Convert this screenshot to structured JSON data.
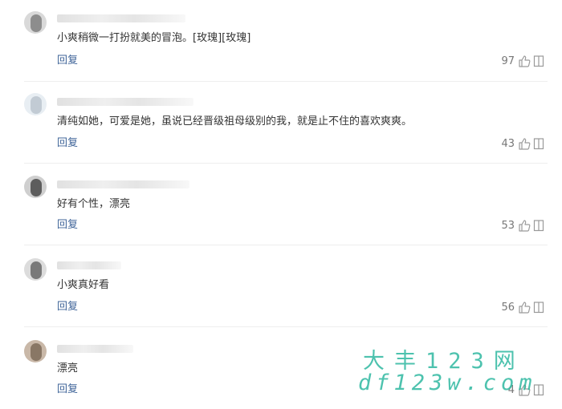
{
  "comments": [
    {
      "text": "小爽稍微一打扮就美的冒泡。[玫瑰][玫瑰]",
      "reply_label": "回复",
      "likes": "97",
      "like_icon": "thumb-up-icon",
      "more_icon": "tray-icon"
    },
    {
      "text": "清纯如她，可爱是她，虽说已经晋级祖母级别的我，就是止不住的喜欢爽爽。",
      "reply_label": "回复",
      "likes": "43",
      "like_icon": "thumb-up-icon",
      "more_icon": "tray-icon"
    },
    {
      "text": "好有个性，漂亮",
      "reply_label": "回复",
      "likes": "53",
      "like_icon": "thumb-up-icon",
      "more_icon": "tray-icon"
    },
    {
      "text": "小爽真好看",
      "reply_label": "回复",
      "likes": "56",
      "like_icon": "thumb-up-icon",
      "more_icon": "tray-icon"
    },
    {
      "text": "漂亮",
      "reply_label": "回复",
      "likes": "4",
      "like_icon": "thumb-up-icon",
      "more_icon": "tray-icon"
    }
  ],
  "watermark": {
    "line1": "大丰123网",
    "line2": "df123w.com"
  },
  "colors": {
    "reply_link": "#406599",
    "text": "#333333",
    "count": "#777777",
    "divider": "#eeeeee",
    "watermark": "#2fb8a0"
  }
}
